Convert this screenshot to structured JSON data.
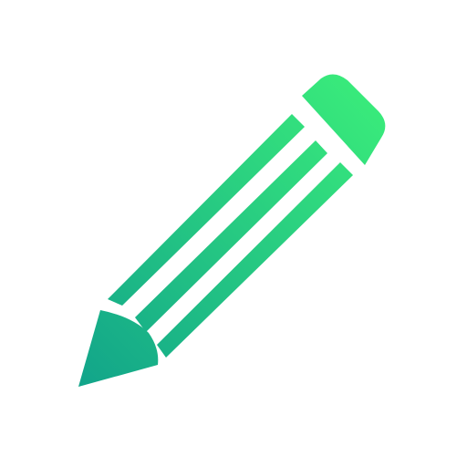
{
  "icon": {
    "name": "pencil-icon",
    "colors": {
      "gradient_start": "#12a58a",
      "gradient_end": "#3bee7a",
      "background": "#ffffff"
    }
  }
}
